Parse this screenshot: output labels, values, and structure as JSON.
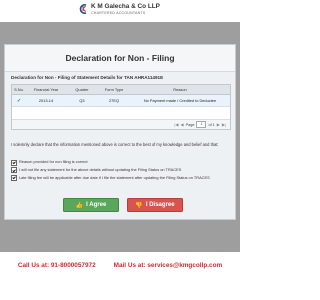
{
  "brand": {
    "name": "K M Galecha & Co LLP",
    "tagline": "CHARTERED ACCOUNTANTS",
    "colors": {
      "accent": "#1f4f8b",
      "red": "#c62f2f"
    }
  },
  "dialog": {
    "title": "Declaration for Non - Filing",
    "subtitle": "Declaration for Non - Filing of Statement Details for TAN AHRA11491E",
    "table": {
      "columns": [
        "S.No.",
        "Financial Year",
        "Quarter",
        "Form Type",
        "Reason"
      ],
      "rows": [
        {
          "sno_icon": "check-icon",
          "financial_year": "2013-14",
          "quarter": "Q3",
          "form_type": "27EQ",
          "reason": "No Payment made / Credited to Deductee"
        }
      ],
      "pager": {
        "label": "Page",
        "current": "1",
        "total_text": "of 1"
      }
    },
    "declaration_text": "I solemnly declare that the information mentioned above is correct to the best of my knowledge and belief and that:",
    "checkboxes": [
      {
        "label": "Reason provided for non filing is correct",
        "checked": true
      },
      {
        "label": "I will not file any statement for the above details without updating the Filing Status on TRACES",
        "checked": true
      },
      {
        "label": "Late filing fee will be applicable after due date if I file the statement after updating the Filing Status on TRACES",
        "checked": true
      }
    ],
    "buttons": {
      "agree": "I Agree",
      "disagree": "I Disagree"
    }
  },
  "footer": {
    "call": "Call Us at: 91-8000057972",
    "mail": "Mail Us at: services@kmgcollp.com"
  }
}
